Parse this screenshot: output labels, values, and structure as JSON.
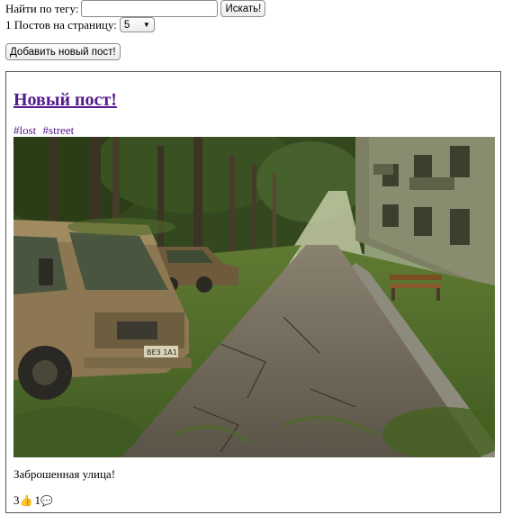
{
  "search": {
    "label": "Найти по тегу:",
    "value": "",
    "placeholder": "",
    "button": "Искать!"
  },
  "paging": {
    "label": "1 Постов на страницу:",
    "selected": "5"
  },
  "add_button": "Добавить новый пост!",
  "posts": [
    {
      "title": "Новый пост!",
      "tags": [
        "#lost",
        "#street"
      ],
      "caption": "Заброшенная улица!",
      "likes": "3",
      "like_icon": "thumbs-up-icon",
      "comments": "1",
      "comment_icon": "speech-bubble-icon",
      "image_plate": "ВЕЗ 1А1"
    }
  ],
  "colors": {
    "link": "#551a8b"
  }
}
